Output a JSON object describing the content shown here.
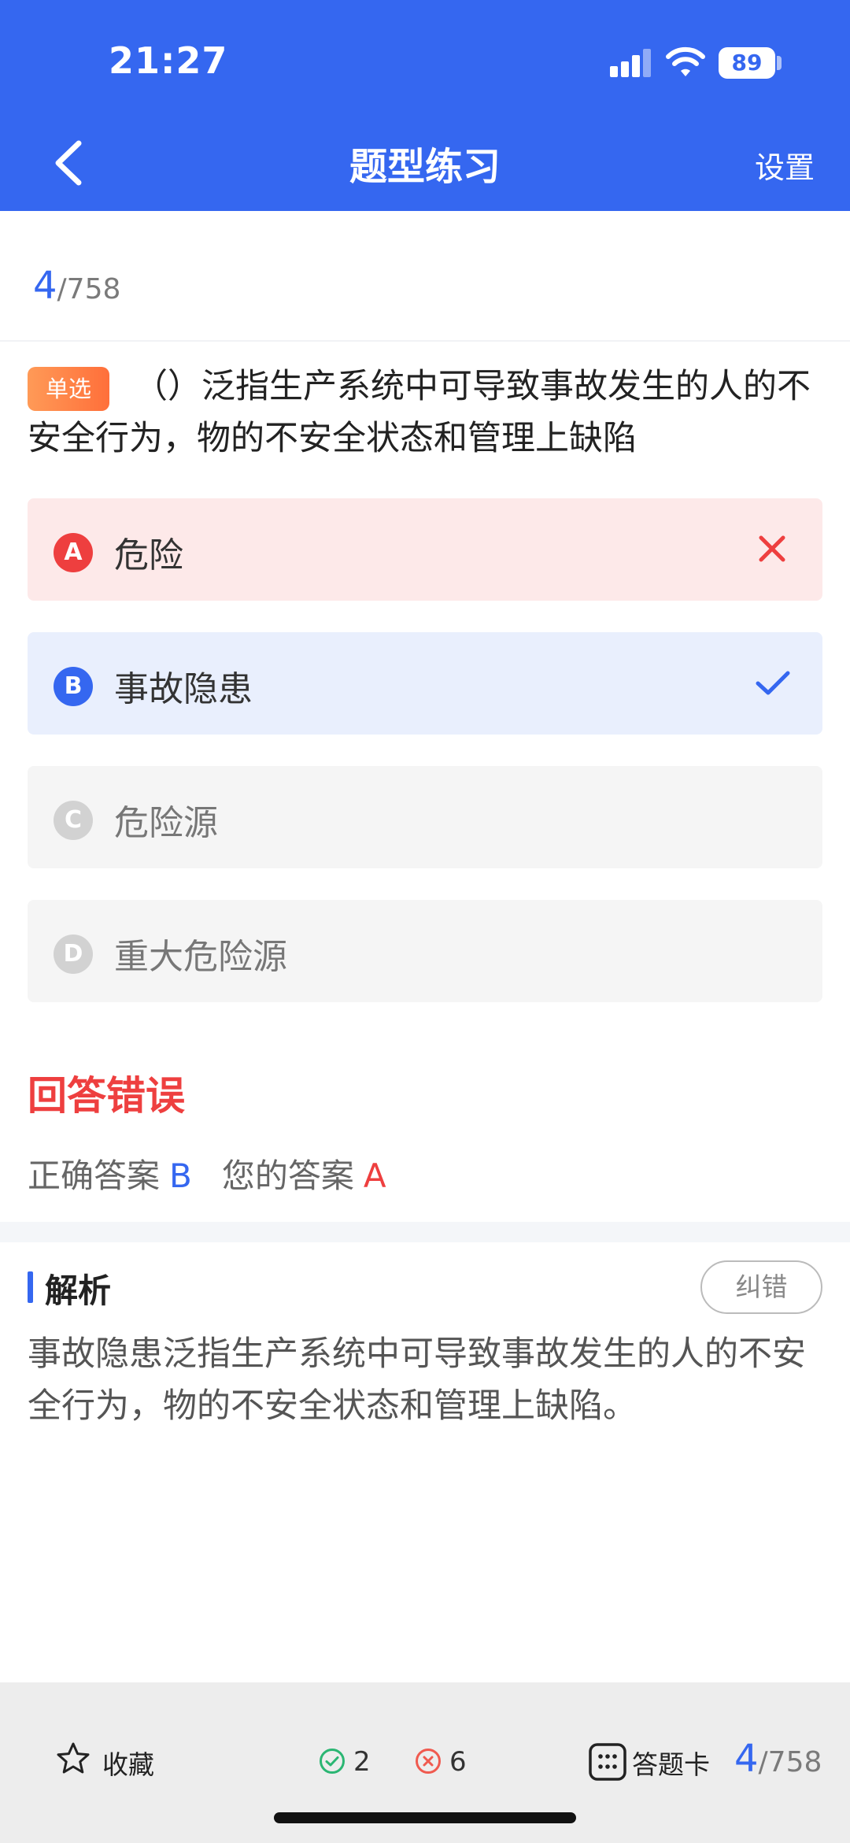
{
  "status": {
    "time": "21:27",
    "battery": "89",
    "icons": [
      "cellular-signal-icon",
      "wifi-icon",
      "battery-icon"
    ]
  },
  "nav": {
    "title": "题型练习",
    "settings_label": "设置",
    "back_icon": "chevron-left-icon"
  },
  "progress": {
    "current": "4",
    "total": "/758"
  },
  "question": {
    "type_badge": "单选",
    "text": "（）泛指生产系统中可导致事故发生的人的不安全行为，物的不安全状态和管理上缺陷"
  },
  "options": [
    {
      "letter": "A",
      "label": "危险",
      "state": "wrong",
      "mark_icon": "cross-icon"
    },
    {
      "letter": "B",
      "label": "事故隐患",
      "state": "correct",
      "mark_icon": "check-icon"
    },
    {
      "letter": "C",
      "label": "危险源",
      "state": "normal"
    },
    {
      "letter": "D",
      "label": "重大危险源",
      "state": "normal"
    }
  ],
  "result": {
    "status_text": "回答错误",
    "correct_label": "正确答案",
    "correct_value": "B",
    "your_label": "您的答案",
    "your_value": "A"
  },
  "analysis": {
    "title": "解析",
    "report_button": "纠错",
    "text": "事故隐患泛指生产系统中可导致事故发生的人的不安全行为，物的不安全状态和管理上缺陷。"
  },
  "bottom_bar": {
    "favorite_label": "收藏",
    "correct_count": "2",
    "wrong_count": "6",
    "answer_card_label": "答题卡",
    "current": "4",
    "total": "/758"
  },
  "colors": {
    "primary": "#3567f0",
    "error": "#ee3f3f",
    "badge": "#ff7d45",
    "correct_count": "#2bb673"
  }
}
